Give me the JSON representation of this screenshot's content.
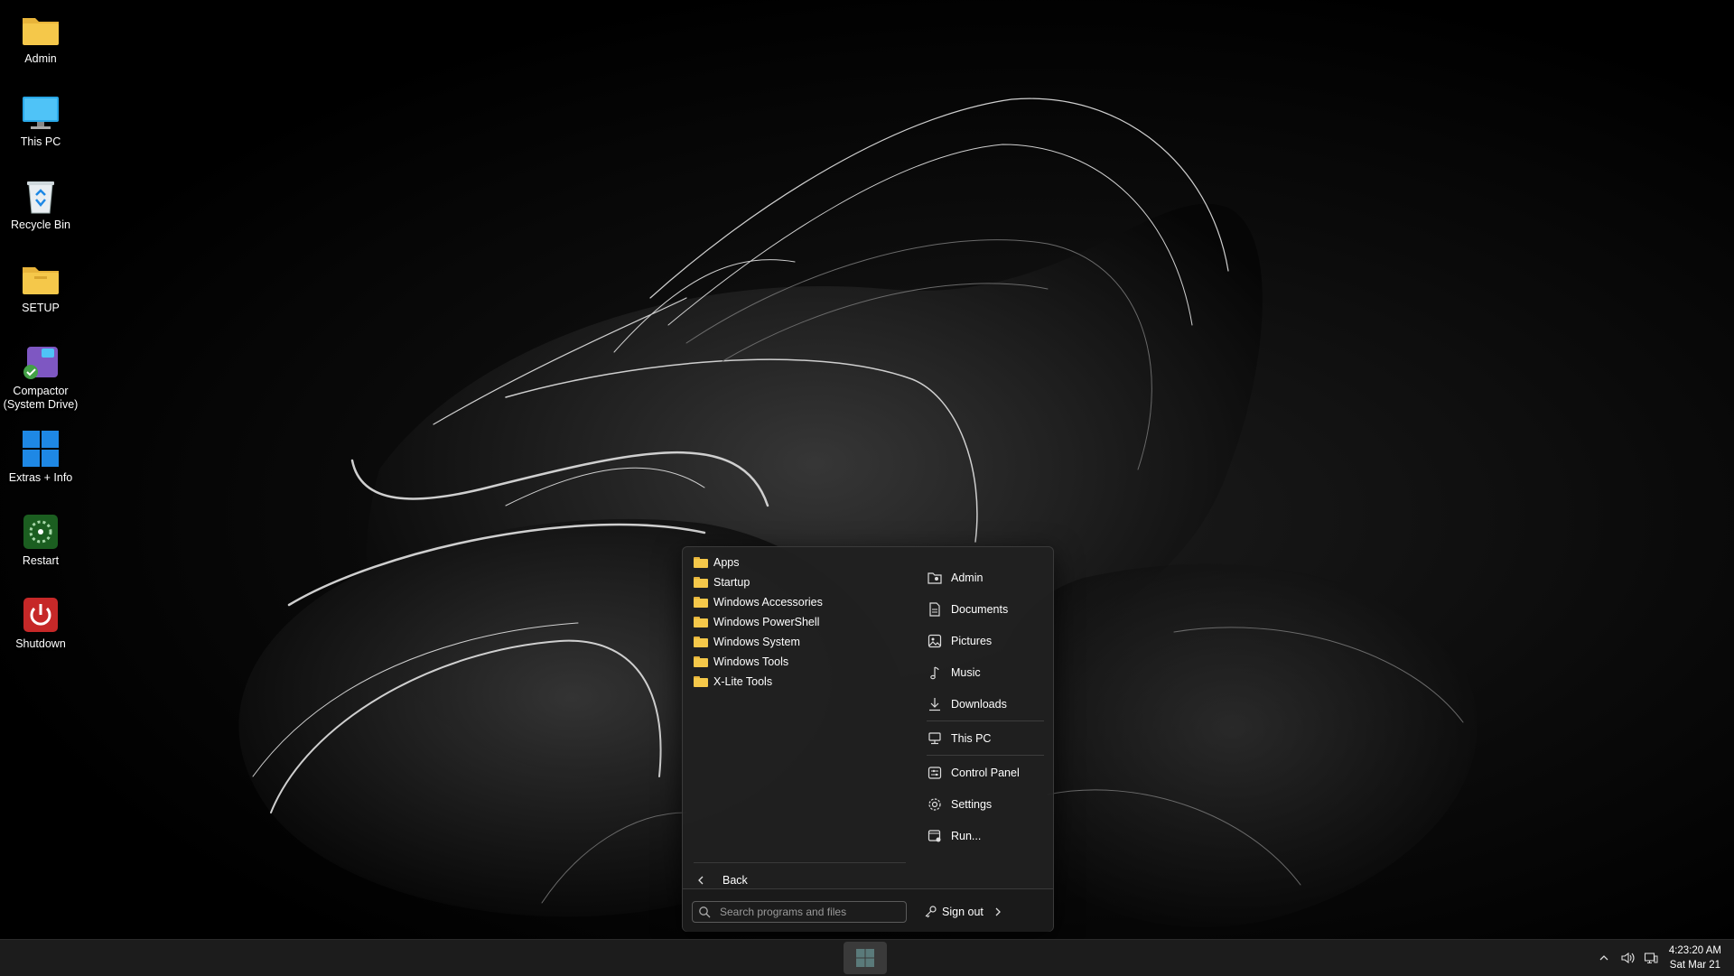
{
  "desktop": {
    "icons": [
      {
        "label": "Admin",
        "icon": "folder-icon"
      },
      {
        "label": "This PC",
        "icon": "monitor-icon"
      },
      {
        "label": "Recycle Bin",
        "icon": "recycle-bin-icon"
      },
      {
        "label": "SETUP",
        "icon": "folder-icon"
      },
      {
        "label": "Compactor (System Drive)",
        "icon": "compactor-icon"
      },
      {
        "label": "Extras + Info",
        "icon": "windows-logo-icon"
      },
      {
        "label": "Restart",
        "icon": "restart-icon"
      },
      {
        "label": "Shutdown",
        "icon": "power-icon"
      }
    ]
  },
  "start_menu": {
    "programs": [
      "Apps",
      "Startup",
      "Windows Accessories",
      "Windows PowerShell",
      "Windows System",
      "Windows Tools",
      "X-Lite Tools"
    ],
    "places": [
      {
        "label": "Admin",
        "icon": "user-folder-icon"
      },
      {
        "label": "Documents",
        "icon": "document-icon"
      },
      {
        "label": "Pictures",
        "icon": "picture-icon"
      },
      {
        "label": "Music",
        "icon": "music-note-icon"
      },
      {
        "label": "Downloads",
        "icon": "download-icon"
      },
      {
        "label": "This PC",
        "icon": "computer-icon"
      },
      {
        "label": "Control Panel",
        "icon": "control-panel-icon"
      },
      {
        "label": "Settings",
        "icon": "gear-icon"
      },
      {
        "label": "Run...",
        "icon": "run-icon"
      }
    ],
    "back_label": "Back",
    "search_placeholder": "Search programs and files",
    "signout_label": "Sign out"
  },
  "taskbar": {
    "time": "4:23:20 AM",
    "date": "Sat Mar 21"
  },
  "colors": {
    "folder": "#f5c84a",
    "menu_bg": "#202020",
    "taskbar_bg": "#1c1c1c",
    "accent_blue": "#1e88e5"
  }
}
